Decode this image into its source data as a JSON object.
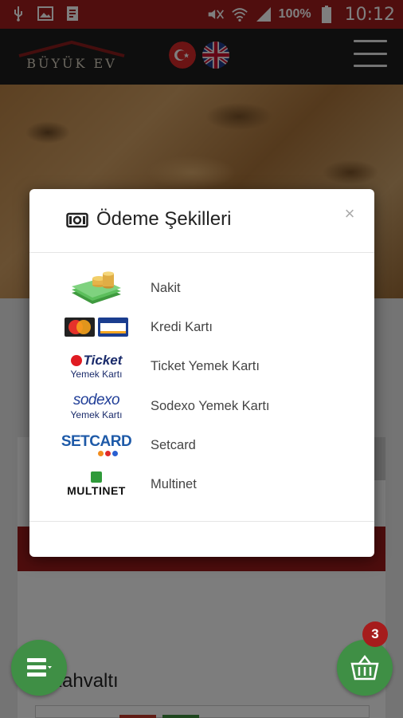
{
  "status_bar": {
    "battery": "100%",
    "time": "10:12"
  },
  "header": {
    "brand": "BÜYÜK EV",
    "flags": [
      "turkish-flag",
      "uk-flag"
    ]
  },
  "modal": {
    "title": "Ödeme Şekilleri",
    "close": "×",
    "payment_methods": [
      {
        "label": "Nakit",
        "logo": "cash-money-icon"
      },
      {
        "label": "Kredi Kartı",
        "logo": "credit-cards-logo"
      },
      {
        "label": "Ticket Yemek Kartı",
        "logo": "ticket-logo",
        "logo_text": "Ticket",
        "logo_sub": "Yemek Kartı"
      },
      {
        "label": "Sodexo Yemek Kartı",
        "logo": "sodexo-logo",
        "logo_text": "sodexo",
        "logo_sub": "Yemek Kartı"
      },
      {
        "label": "Setcard",
        "logo": "setcard-logo",
        "logo_text": "SETCARD"
      },
      {
        "label": "Multinet",
        "logo": "multinet-logo",
        "logo_text": "MULTINET"
      }
    ]
  },
  "page": {
    "section_title": "Kahvaltı"
  },
  "cart": {
    "count": "3"
  },
  "colors": {
    "primary_red": "#a01d1d",
    "fab_green": "#3f8f45",
    "header_dark": "#1c1c1c"
  }
}
